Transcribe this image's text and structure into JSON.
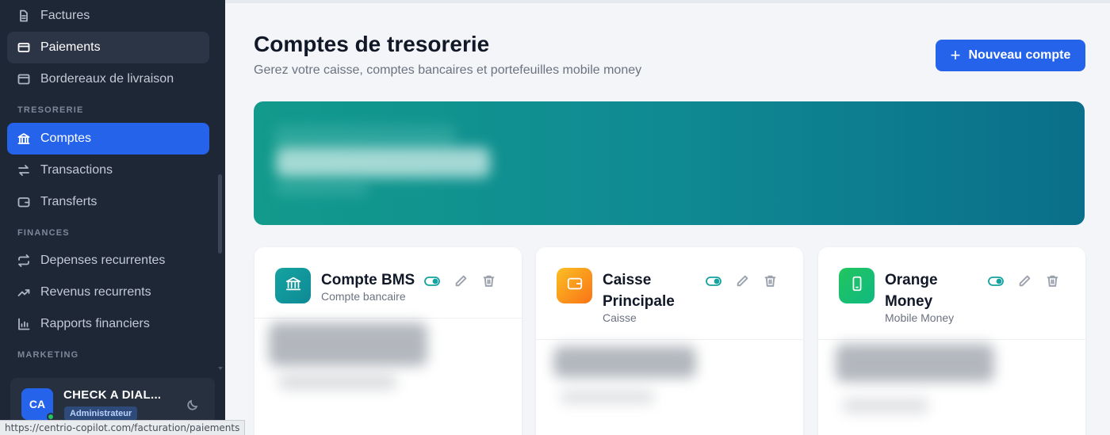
{
  "sidebar": {
    "items_top": [
      {
        "label": "Factures",
        "icon": "file-icon"
      },
      {
        "label": "Paiements",
        "icon": "card-icon"
      },
      {
        "label": "Bordereaux de livraison",
        "icon": "box-icon"
      }
    ],
    "sections": {
      "tresorerie": "TRESORERIE",
      "finances": "FINANCES",
      "marketing": "MARKETING"
    },
    "tresorerie_items": [
      {
        "label": "Comptes",
        "icon": "bank-icon"
      },
      {
        "label": "Transactions",
        "icon": "swap-icon"
      },
      {
        "label": "Transferts",
        "icon": "wallet-icon"
      }
    ],
    "finances_items": [
      {
        "label": "Depenses recurrentes",
        "icon": "repeat-icon"
      },
      {
        "label": "Revenus recurrents",
        "icon": "trend-up-icon"
      },
      {
        "label": "Rapports financiers",
        "icon": "bar-chart-icon"
      }
    ],
    "user": {
      "initials": "CA",
      "name": "CHECK A DIAL...",
      "role": "Administrateur"
    }
  },
  "status_bar": {
    "url": "https://centrio-copilot.com/facturation/paiements"
  },
  "main": {
    "title": "Comptes de tresorerie",
    "subtitle": "Gerez votre caisse, comptes bancaires et portefeuilles mobile money",
    "new_button": "Nouveau compte"
  },
  "accounts": [
    {
      "name": "Compte BMS",
      "type": "Compte bancaire",
      "icon": "bank-icon",
      "color": "#14a3a0"
    },
    {
      "name": "Caisse Principale",
      "type": "Caisse",
      "icon": "wallet-icon",
      "color": "#f59e0b"
    },
    {
      "name": "Orange Money",
      "type": "Mobile Money",
      "icon": "phone-icon",
      "color": "#10b981"
    }
  ],
  "colors": {
    "sidebar_bg": "#1e2736",
    "accent": "#2563eb",
    "banner_start": "#129a8c",
    "banner_end": "#0a6f8a",
    "toggle": "#14a3a0"
  }
}
